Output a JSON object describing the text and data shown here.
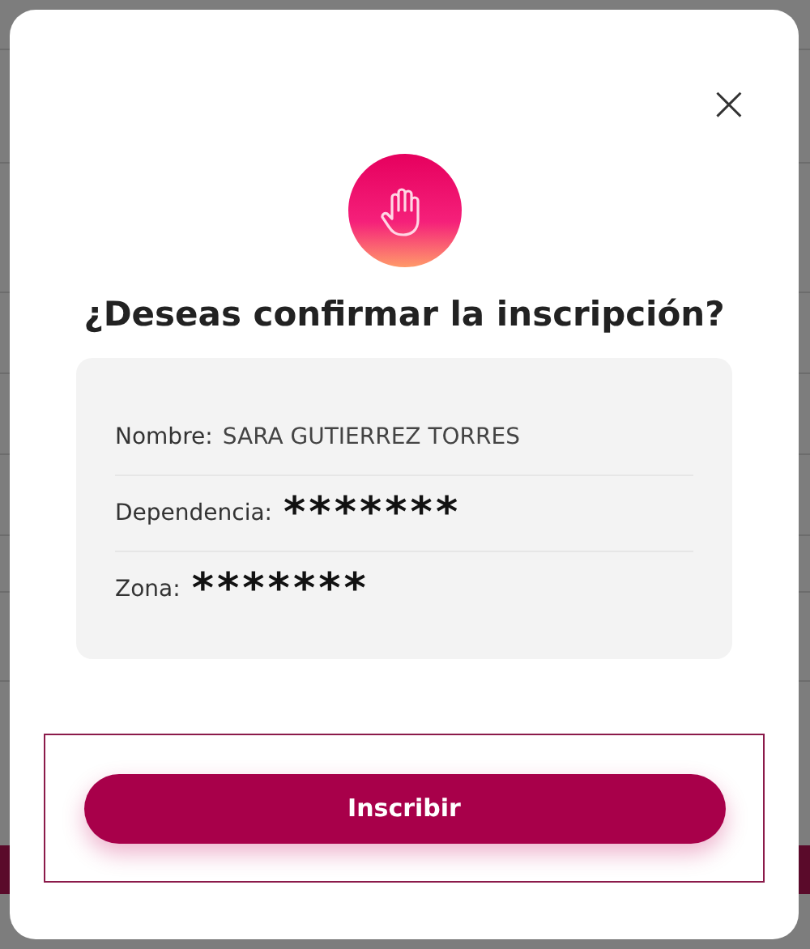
{
  "dialog": {
    "close": "×",
    "title": "¿Deseas confirmar la inscripción?",
    "fields": [
      {
        "label": "Nombre:",
        "value": "SARA GUTIERREZ TORRES",
        "kind": "plain"
      },
      {
        "label": "Dependencia:",
        "value": "*******",
        "kind": "masked"
      },
      {
        "label": "Zona:",
        "value": "*******",
        "kind": "masked"
      }
    ],
    "button": {
      "label": "Inscribir",
      "focused": true
    }
  }
}
